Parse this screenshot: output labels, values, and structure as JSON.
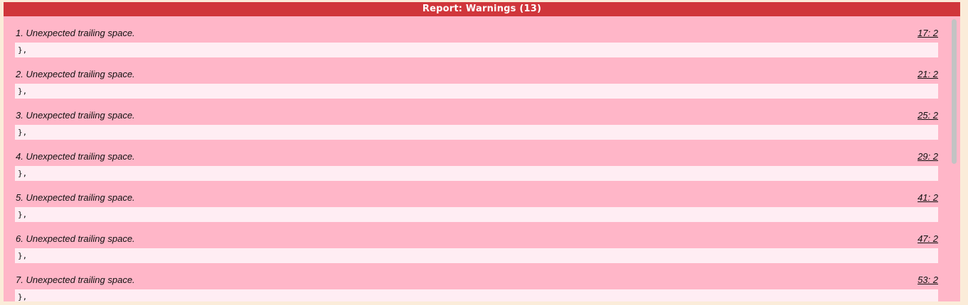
{
  "report": {
    "title": "Report: Warnings (13)",
    "warnings": [
      {
        "message": "1. Unexpected trailing space.",
        "location": "17: 2",
        "code": "},"
      },
      {
        "message": "2. Unexpected trailing space.",
        "location": "21: 2",
        "code": "},"
      },
      {
        "message": "3. Unexpected trailing space.",
        "location": "25: 2",
        "code": "},"
      },
      {
        "message": "4. Unexpected trailing space.",
        "location": "29: 2",
        "code": "},"
      },
      {
        "message": "5. Unexpected trailing space.",
        "location": "41: 2",
        "code": "},"
      },
      {
        "message": "6. Unexpected trailing space.",
        "location": "47: 2",
        "code": "},"
      },
      {
        "message": "7. Unexpected trailing space.",
        "location": "53: 2",
        "code": "},"
      }
    ]
  },
  "colors": {
    "page_background": "#fbecd9",
    "title_bar": "#d0363b",
    "panel": "#ffb6c8",
    "code_background": "#ffedf3",
    "scroll_thumb": "#c3c3c3"
  }
}
